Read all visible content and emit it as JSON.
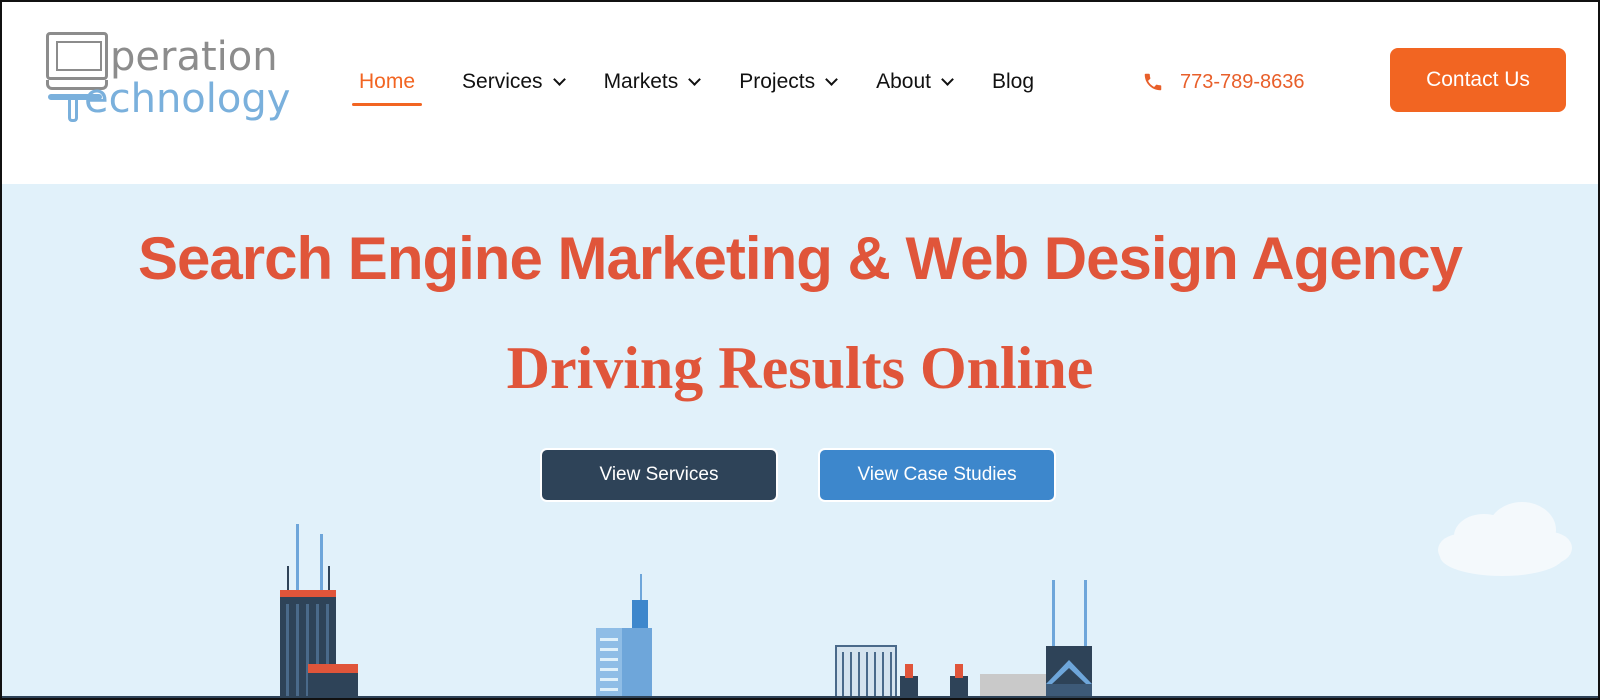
{
  "logo": {
    "line1": "peration",
    "line2": "echnology"
  },
  "nav": {
    "items": [
      {
        "label": "Home",
        "active": true,
        "dropdown": false
      },
      {
        "label": "Services",
        "active": false,
        "dropdown": true
      },
      {
        "label": "Markets",
        "active": false,
        "dropdown": true
      },
      {
        "label": "Projects",
        "active": false,
        "dropdown": true
      },
      {
        "label": "About",
        "active": false,
        "dropdown": true
      },
      {
        "label": "Blog",
        "active": false,
        "dropdown": false
      }
    ]
  },
  "phone": {
    "number": "773-789-8636",
    "icon": "phone-icon"
  },
  "header": {
    "contact_label": "Contact Us"
  },
  "hero": {
    "title": "Search Engine Marketing & Web Design Agency",
    "subtitle": "Driving Results Online",
    "primary_button": "View Services",
    "secondary_button": "View Case Studies"
  },
  "colors": {
    "accent": "#f26522",
    "headline": "#e0553a",
    "hero_bg": "#e1f1fa",
    "dark_button": "#2e4358",
    "blue_button": "#3d87cc",
    "logo_gray": "#8c8c8c",
    "logo_blue": "#7ab0dc"
  }
}
